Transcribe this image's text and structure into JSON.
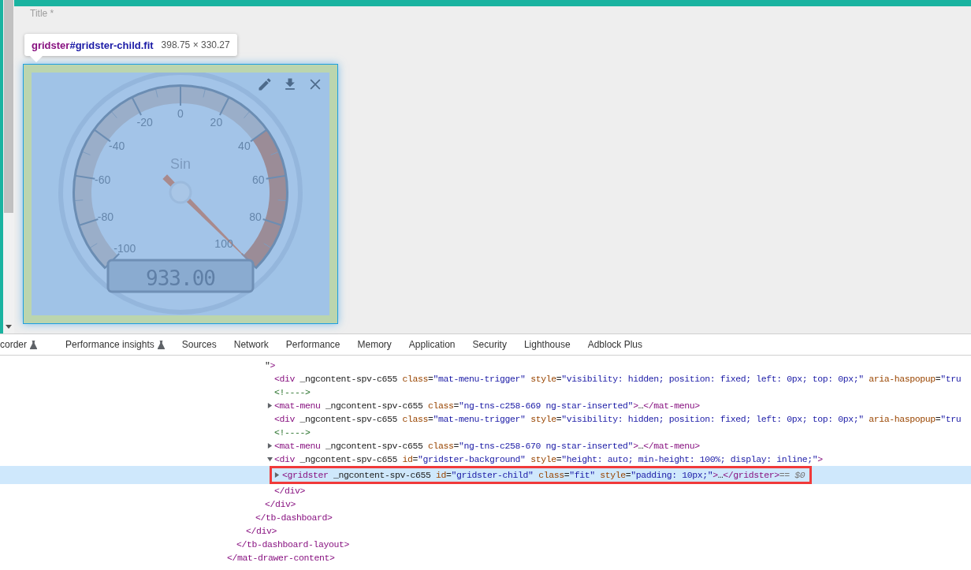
{
  "page": {
    "field_label": "Title *"
  },
  "tooltip": {
    "selector": "gridster#gridster-child.fit",
    "size": "398.75 × 330.27"
  },
  "gauge": {
    "title": "Sin",
    "value": "933.00",
    "ticks": [
      "-100",
      "-80",
      "-60",
      "-40",
      "-20",
      "0",
      "20",
      "40",
      "60",
      "80",
      "100"
    ]
  },
  "devtools_tabs": [
    {
      "label": "corder",
      "kind": "experimental",
      "selected": false
    },
    {
      "label": "Performance insights",
      "kind": "experimental",
      "selected": false
    },
    {
      "label": "Sources",
      "kind": "plain",
      "selected": false
    },
    {
      "label": "Network",
      "kind": "plain",
      "selected": false
    },
    {
      "label": "Performance",
      "kind": "plain",
      "selected": false
    },
    {
      "label": "Memory",
      "kind": "plain",
      "selected": false
    },
    {
      "label": "Application",
      "kind": "plain",
      "selected": false
    },
    {
      "label": "Security",
      "kind": "plain",
      "selected": false
    },
    {
      "label": "Lighthouse",
      "kind": "plain",
      "selected": false
    },
    {
      "label": "Adblock Plus",
      "kind": "plain",
      "selected": false
    }
  ],
  "dom_tree": [
    {
      "selected": false,
      "close": "</mat-drawer-content>",
      "children": [
        {
          "selected": false,
          "close": "</tb-dashboard-layout>",
          "children": [
            {
              "selected": false,
              "close": "</div>",
              "children": [
                {
                  "selected": false,
                  "close": "</tb-dashboard>",
                  "children": [
                    {
                      "selected": false,
                      "text": "\">",
                      "close": "</div>",
                      "children": [
                        {
                          "kind": "leaf",
                          "selected": false,
                          "text": "<div _ngcontent-spv-c655 class=\"mat-menu-trigger\" style=\"visibility: hidden; position: fixed; left: 0px; top: 0px;\" aria-haspopup=\"tru"
                        },
                        {
                          "kind": "leaf",
                          "selected": false,
                          "text": "<!---->"
                        },
                        {
                          "kind": "collapsed",
                          "selected": false,
                          "text": "<mat-menu _ngcontent-spv-c655 class=\"ng-tns-c258-669 ng-star-inserted\">…</mat-menu>"
                        },
                        {
                          "kind": "leaf",
                          "selected": false,
                          "text": "<div _ngcontent-spv-c655 class=\"mat-menu-trigger\" style=\"visibility: hidden; position: fixed; left: 0px; top: 0px;\" aria-haspopup=\"tru"
                        },
                        {
                          "kind": "leaf",
                          "selected": false,
                          "text": "<!---->"
                        },
                        {
                          "kind": "collapsed",
                          "selected": false,
                          "text": "<mat-menu _ngcontent-spv-c655 class=\"ng-tns-c258-670 ng-star-inserted\">…</mat-menu>"
                        },
                        {
                          "kind": "expanded",
                          "selected": false,
                          "text": "<div _ngcontent-spv-c655 id=\"gridster-background\" style=\"height: auto; min-height: 100%; display: inline;\">",
                          "close": "</div>",
                          "children": [
                            {
                              "kind": "collapsed",
                              "selected": true,
                              "text": "<gridster _ngcontent-spv-c655 id=\"gridster-child\" class=\"fit\" style=\"padding: 10px;\">…</gridster>",
                              "console_ref": "== $0"
                            }
                          ]
                        }
                      ]
                    }
                  ]
                }
              ]
            }
          ]
        }
      ]
    }
  ]
}
